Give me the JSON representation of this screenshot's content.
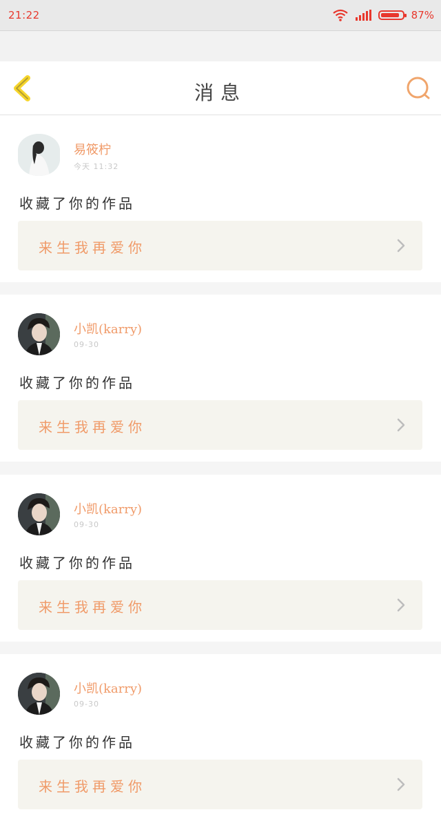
{
  "status_bar": {
    "time": "21:22",
    "battery": "87%",
    "battery_level": 0.87,
    "color": "#e8372c"
  },
  "header": {
    "title": "消息",
    "back_icon": "chevron-left-icon",
    "search_icon": "search-icon",
    "accent": "#f0a56c"
  },
  "messages": [
    {
      "user": "易筱柠",
      "time": "今天 11:32",
      "action": "收藏了你的作品",
      "work": "来生我再爱你"
    },
    {
      "user": "小凯(karry)",
      "time": "09-30",
      "action": "收藏了你的作品",
      "work": "来生我再爱你"
    },
    {
      "user": "小凯(karry)",
      "time": "09-30",
      "action": "收藏了你的作品",
      "work": "来生我再爱你"
    },
    {
      "user": "小凯(karry)",
      "time": "09-30",
      "action": "收藏了你的作品",
      "work": "来生我再爱你"
    }
  ]
}
